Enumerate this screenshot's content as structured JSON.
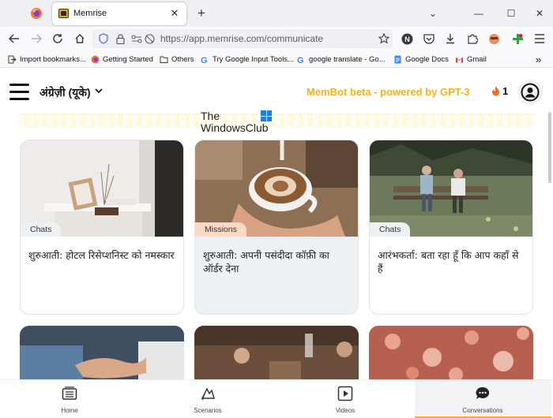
{
  "browser": {
    "tab": {
      "title": "Memrise"
    },
    "url": "https://app.memrise.com/communicate",
    "bookmarks": [
      {
        "label": "Import bookmarks...",
        "icon": "import-icon"
      },
      {
        "label": "Getting Started",
        "icon": "firefox-icon"
      },
      {
        "label": "Others",
        "icon": "folder-icon"
      },
      {
        "label": "Try Google Input Tools...",
        "icon": "google-icon"
      },
      {
        "label": "google translate - Go...",
        "icon": "google-icon"
      },
      {
        "label": "Google Docs",
        "icon": "docs-icon"
      },
      {
        "label": "Gmail",
        "icon": "gmail-icon"
      }
    ]
  },
  "header": {
    "language": "अंग्रेज़ी (यूके)",
    "membot": "MemBot beta - powered by GPT-3",
    "streak": "1"
  },
  "watermark": {
    "line1": "The",
    "line2": "WindowsClub"
  },
  "cards": [
    {
      "tag": "Chats",
      "title": "शुरुआती: होटल रिसेप्शनिस्ट को नमस्कार",
      "tag_color": "#eef0f3"
    },
    {
      "tag": "Missions",
      "title": "शुरुआती: अपनी पसंदीदा कॉफ़ी का ऑर्डर देना",
      "tag_color": "#fbd9c4"
    },
    {
      "tag": "Chats",
      "title": "आरंभकर्ता: बता रहा हूँ कि आप कहाँ से हैं",
      "tag_color": "#eef0f3"
    }
  ],
  "bottom_nav": [
    {
      "label": "Home",
      "icon": "home-book-icon"
    },
    {
      "label": "Scenarios",
      "icon": "scenarios-icon"
    },
    {
      "label": "Videos",
      "icon": "videos-icon"
    },
    {
      "label": "Conversations",
      "icon": "chat-bubble-icon",
      "active": true
    }
  ],
  "colors": {
    "accent": "#f5b21a"
  }
}
